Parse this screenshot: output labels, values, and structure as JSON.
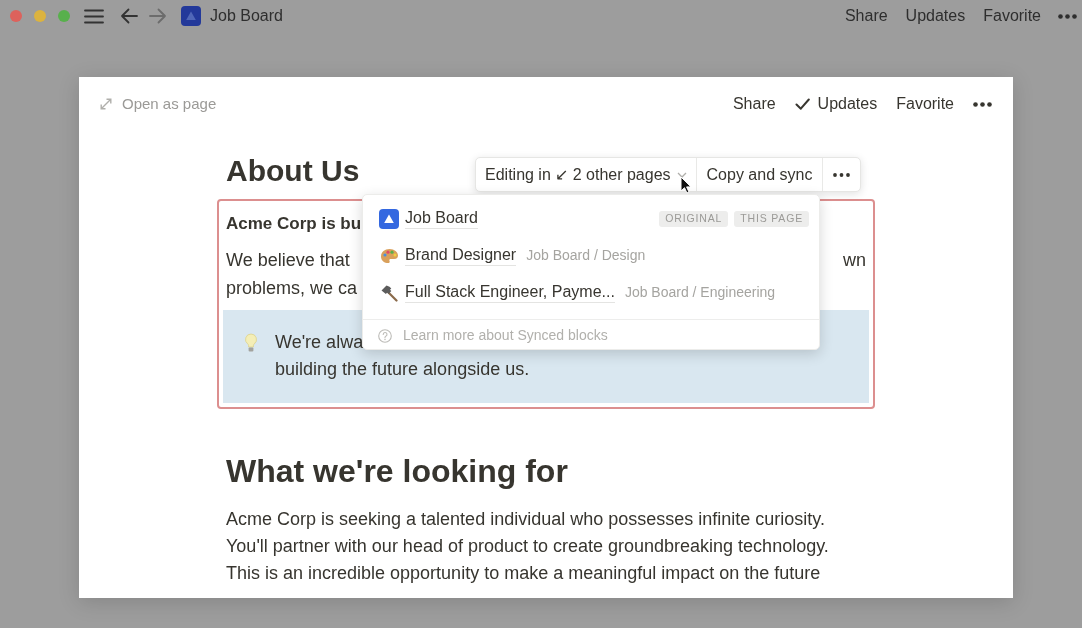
{
  "window_controls": [
    {
      "color": "#dd625c"
    },
    {
      "color": "#dcb33f"
    },
    {
      "color": "#58b04c"
    }
  ],
  "top_bar": {
    "page_title": "Job Board",
    "actions": [
      "Share",
      "Updates",
      "Favorite"
    ]
  },
  "peek": {
    "open_as_page": "Open as page",
    "actions": [
      {
        "label": "Share",
        "kind": "plain"
      },
      {
        "label": "Updates",
        "kind": "check"
      },
      {
        "label": "Favorite",
        "kind": "plain"
      }
    ]
  },
  "page": {
    "title": "About Us",
    "synced_block": {
      "lead": "Acme Corp is bu",
      "lines": [
        {
          "left": "We believe that",
          "right": "wn"
        },
        {
          "left": "problems, we ca"
        }
      ],
      "callout": {
        "lines": [
          "We're alwa",
          "building the future alongside us."
        ]
      }
    },
    "section_title": "What we're looking for",
    "paragraph": "Acme Corp is seeking a talented individual who possesses infinite curiosity. You'll partner with our head of product to create groundbreaking technology. This is an incredible opportunity to make a meaningful impact on the future"
  },
  "sync_toolbar": {
    "editing": "Editing in ↙ 2 other pages",
    "copy": "Copy and sync"
  },
  "sync_menu": {
    "pages": [
      {
        "kind": "tile",
        "title": "Job Board",
        "badges": [
          "ORIGINAL",
          "THIS PAGE"
        ]
      },
      {
        "kind": "palette",
        "title": "Brand Designer",
        "path": "Job Board / Design"
      },
      {
        "kind": "hammer",
        "title": "Full Stack Engineer, Payme...",
        "path": "Job Board / Engineering"
      }
    ],
    "help": "Learn more about Synced blocks"
  }
}
